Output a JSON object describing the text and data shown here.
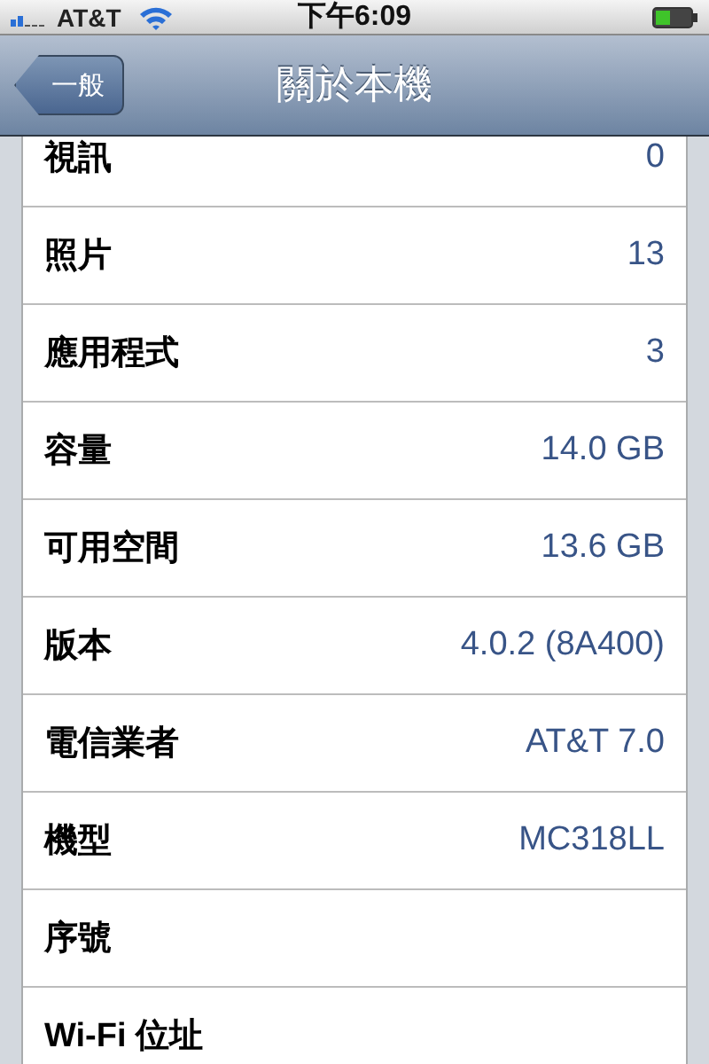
{
  "status_bar": {
    "carrier": "AT&T",
    "time": "下午6:09"
  },
  "nav_bar": {
    "back_button": "一般",
    "title": "關於本機"
  },
  "rows": [
    {
      "label": "視訊",
      "value": "0"
    },
    {
      "label": "照片",
      "value": "13"
    },
    {
      "label": "應用程式",
      "value": "3"
    },
    {
      "label": "容量",
      "value": "14.0 GB"
    },
    {
      "label": "可用空間",
      "value": "13.6 GB"
    },
    {
      "label": "版本",
      "value": "4.0.2 (8A400)"
    },
    {
      "label": "電信業者",
      "value": "AT&T 7.0"
    },
    {
      "label": "機型",
      "value": "MC318LL"
    },
    {
      "label": "序號"
    },
    {
      "label": "Wi-Fi 位址"
    }
  ]
}
